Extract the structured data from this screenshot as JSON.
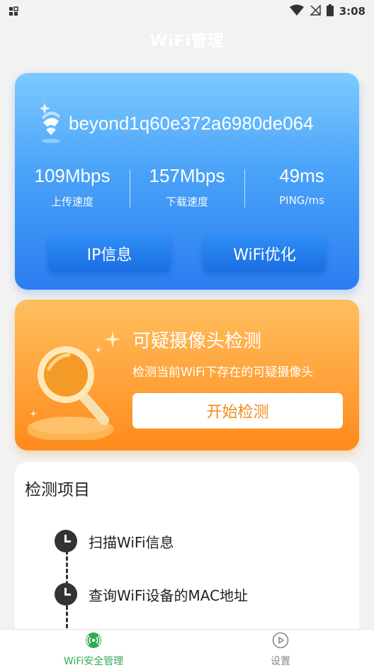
{
  "status_bar": {
    "time": "3:08"
  },
  "header": {
    "title": "WiFi管理"
  },
  "wifi_card": {
    "ssid": "beyond1q60e372a6980de064",
    "stats": [
      {
        "value": "109Mbps",
        "label": "上传速度"
      },
      {
        "value": "157Mbps",
        "label": "下载速度"
      },
      {
        "value": "49ms",
        "label": "PING/ms"
      }
    ],
    "ip_button": "IP信息",
    "optimize_button": "WiFi优化"
  },
  "camera_card": {
    "title": "可疑摄像头检测",
    "description": "检测当前WiFi下存在的可疑摄像头",
    "start_button": "开始检测"
  },
  "detect_card": {
    "title": "检测项目",
    "items": [
      {
        "label": "扫描WiFi信息"
      },
      {
        "label": "查询WiFi设备的MAC地址"
      }
    ]
  },
  "bottom_nav": {
    "items": [
      {
        "label": "WiFi安全管理",
        "icon": "wifi-signal-icon",
        "active": true
      },
      {
        "label": "设置",
        "icon": "play-circle-icon",
        "active": false
      }
    ]
  },
  "colors": {
    "wifi_card_top": "#7dcaff",
    "wifi_card_bottom": "#2b7df0",
    "camera_card_top": "#ffbf5f",
    "camera_card_bottom": "#ff8a1a",
    "active_nav": "#34a853"
  }
}
